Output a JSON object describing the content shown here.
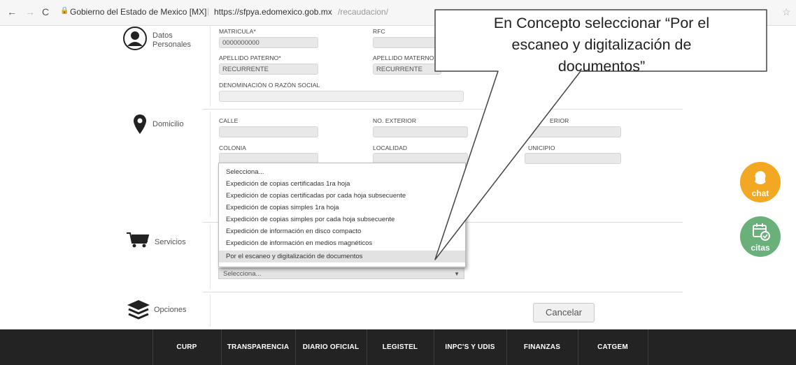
{
  "browser": {
    "site_identity": "Gobierno del Estado de Mexico [MX]",
    "url_host": "https://sfpya.edomexico.gob.mx",
    "url_path": "/recaudacion/"
  },
  "datos_personales": {
    "label": "Datos Personales",
    "matricula_label": "MATRICULA*",
    "matricula_value": "0000000000",
    "rfc_label": "RFC",
    "apellido_paterno_label": "APELLIDO PATERNO*",
    "apellido_paterno_value": "RECURRENTE",
    "apellido_materno_label": "APELLIDO MATERNO",
    "apellido_materno_value": "RECURRENTE",
    "denominacion_label": "DENOMINACIÓN O RAZÓN SOCIAL"
  },
  "domicilio": {
    "label": "Domicilio",
    "calle_label": "CALLE",
    "no_exterior_label": "NO. EXTERIOR",
    "no_interior_label": "ERIOR",
    "colonia_label": "COLONIA",
    "localidad_label": "LOCALIDAD",
    "municipio_label": "UNICIPIO"
  },
  "servicios": {
    "label": "Servicios",
    "dropdown_options": [
      "Selecciona...",
      "Expedición de copias certificadas 1ra hoja",
      "Expedición de copias certificadas por cada hoja subsecuente",
      "Expedición de copias simples 1ra hoja",
      "Expedición de copias simples por cada hoja subsecuente",
      "Expedición de información en disco compacto",
      "Expedición de información en medios magnéticos",
      "Por el escaneo y digitalización de documentos"
    ],
    "selected_index": 7,
    "collapsed_select_value": "Selecciona..."
  },
  "opciones": {
    "label": "Opciones",
    "cancel_label": "Cancelar"
  },
  "callout": {
    "line1": "En Concepto seleccionar “Por el",
    "line2": "escaneo y digitalización de",
    "line3": "documentos”"
  },
  "floating": {
    "chat_label": "chat",
    "citas_label": "citas"
  },
  "footer": {
    "items": [
      "CURP",
      "TRANSPARENCIA",
      "DIARIO OFICIAL",
      "LEGISTEL",
      "INPC'S Y UDIS",
      "FINANZAS",
      "CATGEM"
    ]
  },
  "colors": {
    "footer_bg": "#232323",
    "chat_bg": "#f3a823",
    "citas_bg": "#6ab07a",
    "field_bg": "#e8e8e8"
  }
}
